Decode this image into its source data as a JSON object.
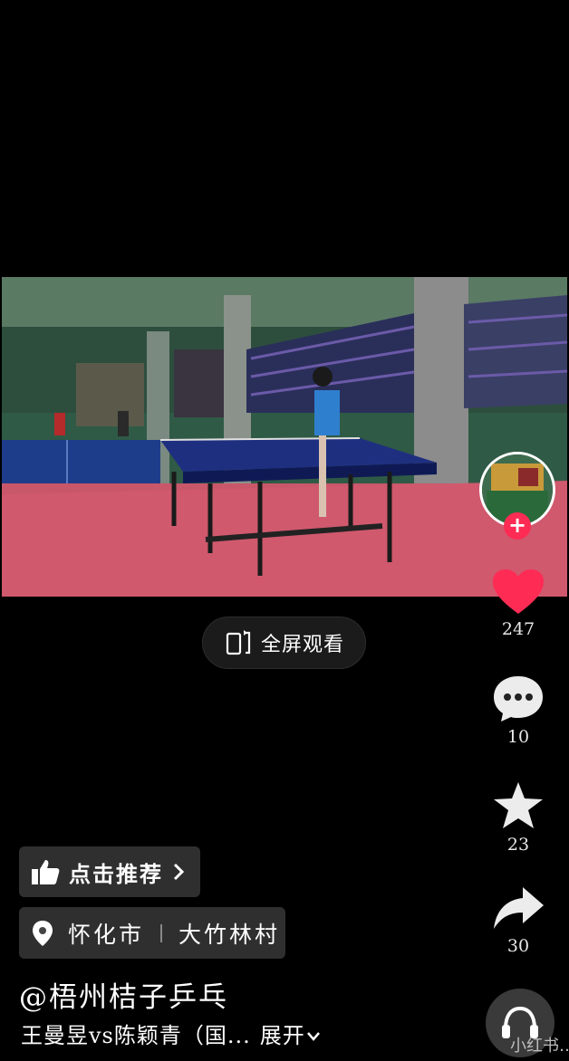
{
  "video": {
    "fullscreen_label": "全屏观看"
  },
  "actions": {
    "likes": "247",
    "comments": "10",
    "favorites": "23",
    "shares": "30"
  },
  "recommend": {
    "label": "点击推荐"
  },
  "location": {
    "city": "怀化市",
    "place": "大竹林村"
  },
  "post": {
    "author": "@梧州桔子乒乓",
    "description": "王曼昱vs陈颖青（国...",
    "expand_label": "展开"
  },
  "music": {
    "label": "小红书…"
  },
  "colors": {
    "like": "#fe2c55",
    "background": "#000000"
  }
}
